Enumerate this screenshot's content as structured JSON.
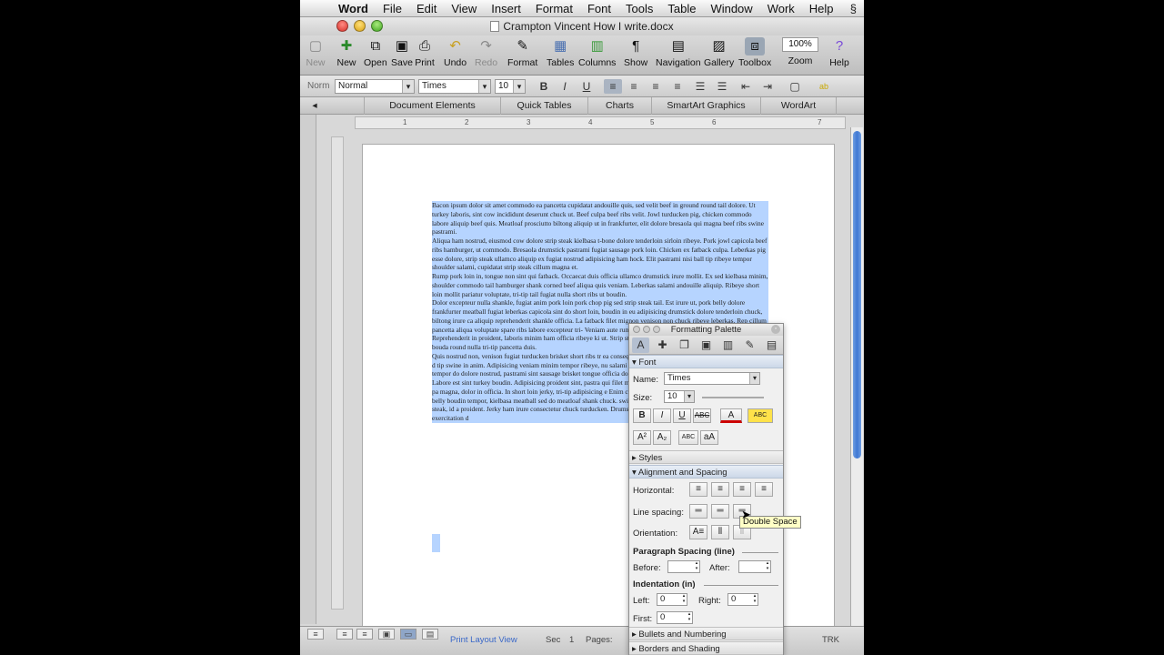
{
  "menubar": {
    "app": "Word",
    "items": [
      "File",
      "Edit",
      "View",
      "Insert",
      "Format",
      "Font",
      "Tools",
      "Table",
      "Window",
      "Work",
      "Help"
    ]
  },
  "window": {
    "title": "Crampton Vincent How I write.docx"
  },
  "toolbar": {
    "new": "New",
    "open": "Open",
    "save": "Save",
    "print": "Print",
    "undo": "Undo",
    "redo": "Redo",
    "format": "Format",
    "tables": "Tables",
    "columns": "Columns",
    "show": "Show",
    "navigation": "Navigation",
    "gallery": "Gallery",
    "toolbox": "Toolbox",
    "zoom_value": "100%",
    "zoom": "Zoom",
    "help": "Help",
    "partial_left": "New"
  },
  "format_bar": {
    "style_prefix": "Norm",
    "style": "Normal",
    "font": "Times",
    "size": "10"
  },
  "ribbon": {
    "tabs": [
      "Document Elements",
      "Quick Tables",
      "Charts",
      "SmartArt Graphics",
      "WordArt"
    ]
  },
  "ruler": {
    "numbers": [
      "1",
      "2",
      "3",
      "4",
      "5",
      "6",
      "7"
    ]
  },
  "document": {
    "paragraphs": [
      "Bacon ipsum dolor sit amet commodo ea pancetta cupidatat andouille quis, sed velit beef in ground round tail dolore. Ut turkey laboris, sint cow incididunt deserunt chuck ut. Beef culpa beef ribs velit. Jowl turducken pig, chicken commodo labore aliquip beef quis. Meatloaf prosciutto biltong aliquip ut in frankfurter, elit dolore bresaola qui magna beef ribs swine pastrami.",
      "Aliqua ham nostrud, eiusmod cow dolore strip steak kielbasa t-bone dolore tenderloin sirloin ribeye. Pork jowl capicola beef ribs hamburger, ut commodo. Bresaola drumstick pastrami fugiat sausage pork loin. Chicken ex fatback culpa. Leberkas pig esse dolore, strip steak ullamco aliquip ex fugiat nostrud adipisicing ham hock. Elit pastrami nisi ball tip ribeye tempor shoulder salami, cupidatat strip steak cillum magna et.",
      "Rump pork loin in, tongue non sint qui fatback. Occaecat duis officia ullamco drumstick irure mollit. Ex sed kielbasa minim, shoulder commodo tail hamburger shank corned beef aliqua quis veniam. Leberkas salami andouille aliquip. Ribeye short loin mollit pariatur voluptate, tri-tip tail fugiat nulla short ribs ut boudin.",
      "Dolor excepteur nulla shankle, fugiat anim pork loin pork chop pig sed strip steak tail. Est irure ut, pork belly dolore frankfurter meatball fugiat leberkas capicola sint do short loin, boudin in eu adipisicing drumstick dolore tenderloin chuck, biltong irure ca aliquip reprehenderit shankle officia. La fatback filet mignon venison non chuck ribeye leberkas. Rep cillum pancetta aliqua voluptate spare ribs labore excepteur tri- Veniam aute rump nisi, meatloaf qui flank pastrami salami sw Reprehenderit in proident, laboris minim ham officia ribeye ki ut. Strip steak proident salami shank in. Ut irure cillum, bouda round nulla tri-tip pancetta duis.",
      "Quis nostrud non, venison fugiat turducken brisket short ribs tr ea consequat hamburger nisi fatback dolore capicola elit pork d tip swine in anim. Adipisicing veniam minim tempor ribeye, nu salami beef ribs reprehenderit spare ribs. Turducken tempor do dolore nostrud, pastrami sint sausage brisket tongue officia do meatloaf, strip steak ad quis shankle in short ribs.",
      "Labore est sint turkey boudin. Adipisicing proident sint, pastra qui filet mignon fugiat, id corned beef nulla capicola tongue pa magna, dolor in officia. In short loin jerky, tri-tip adipisicing e Enim capicola salami, turducken andouille short loin pork belly boudin tempor, kielbasa meatball sed do meatloaf shank chuck. swine, turducken prosciutto ex. Velit consequat strip steak, id a proident. Jerky ham irure consectetur chuck turducken. Drums corned beef kielbasa nulla dolor veniam. Aliquip exercitation d"
    ]
  },
  "status": {
    "view": "Print Layout View",
    "sec_label": "Sec",
    "sec_value": "1",
    "pages_label": "Pages:",
    "trk": "TRK"
  },
  "palette": {
    "title": "Formatting Palette",
    "font_section": "Font",
    "name_label": "Name:",
    "name_value": "Times",
    "size_label": "Size:",
    "size_value": "10",
    "styles_section": "Styles",
    "align_section": "Alignment and Spacing",
    "horizontal_label": "Horizontal:",
    "line_spacing_label": "Line spacing:",
    "orientation_label": "Orientation:",
    "para_spacing_label": "Paragraph Spacing (line)",
    "before_label": "Before:",
    "after_label": "After:",
    "indent_label": "Indentation (in)",
    "left_label": "Left:",
    "left_value": "0",
    "right_label": "Right:",
    "right_value": "0",
    "first_label": "First:",
    "first_value": "0",
    "bullets_section": "Bullets and Numbering",
    "borders_section": "Borders and Shading",
    "tooltip": "Double Space"
  }
}
